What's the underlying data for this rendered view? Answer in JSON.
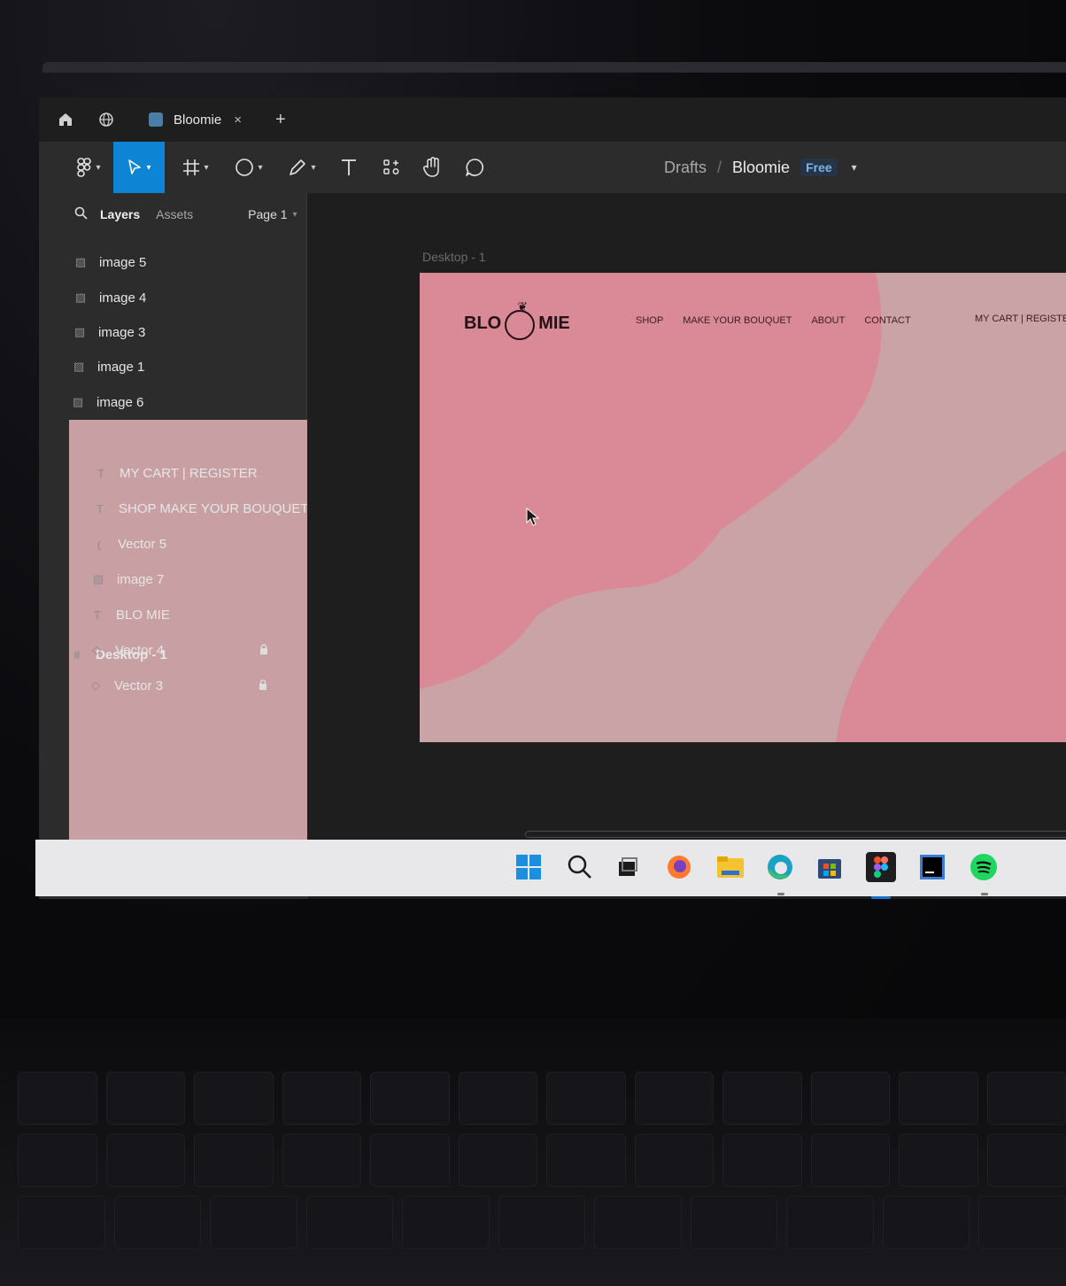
{
  "tabbar": {
    "home_icon": "home-icon",
    "globe_icon": "globe-icon",
    "tab_title": "Bloomie",
    "tab_close": "×",
    "tab_add": "+"
  },
  "toolbar": {
    "tools": [
      "main-menu",
      "move",
      "frame",
      "shape",
      "pen",
      "text",
      "resources",
      "hand",
      "comment"
    ],
    "breadcrumb_drafts": "Drafts",
    "breadcrumb_sep": "/",
    "file_name": "Bloomie",
    "plan_badge": "Free"
  },
  "panel": {
    "tab_layers": "Layers",
    "tab_assets": "Assets",
    "page": "Page 1",
    "layers": [
      {
        "name": "image 5",
        "type": "image"
      },
      {
        "name": "image 4",
        "type": "image"
      },
      {
        "name": "image 3",
        "type": "image"
      },
      {
        "name": "image 1",
        "type": "image"
      },
      {
        "name": "image 6",
        "type": "image"
      },
      {
        "name": "Desktop - 1",
        "type": "frame"
      },
      {
        "name": "MY CART | REGISTER",
        "type": "text"
      },
      {
        "name": "SHOP MAKE YOUR BOUQUET...",
        "type": "text"
      },
      {
        "name": "Vector 5",
        "type": "vector"
      },
      {
        "name": "image 7",
        "type": "image"
      },
      {
        "name": "BLO MIE",
        "type": "text"
      },
      {
        "name": "Vector 4",
        "type": "vector",
        "locked": true
      },
      {
        "name": "Vector 3",
        "type": "vector",
        "locked": true
      }
    ]
  },
  "canvas": {
    "frame_label": "Desktop - 1",
    "logo_left": "BLO",
    "logo_right": "MIE",
    "nav": [
      "SHOP",
      "MAKE YOUR BOUQUET",
      "ABOUT",
      "CONTACT"
    ],
    "mycart": "MY CART | REGISTE",
    "colors": {
      "blob_dark": "#d98a96",
      "blob_light": "#c8a0a4"
    }
  },
  "taskbar": {
    "apps": [
      "windows-start",
      "search",
      "task-view",
      "firefox",
      "file-explorer",
      "edge",
      "microsoft-store",
      "figma",
      "intellij",
      "spotify"
    ]
  }
}
